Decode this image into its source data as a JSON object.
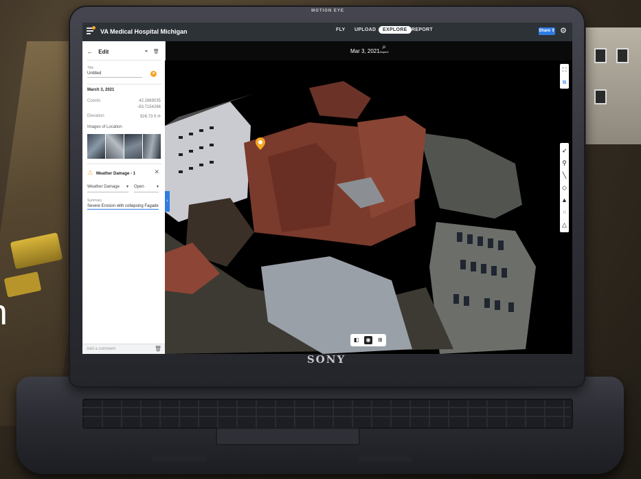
{
  "laptop": {
    "top_brand": "MOTION EYE",
    "bottom_brand": "SONY"
  },
  "app": {
    "title": "VA Medical Hospital Michigan",
    "nav": [
      "FLY",
      "UPLOAD",
      "EXPLORE",
      "REPORT"
    ],
    "active_nav": "EXPLORE",
    "share_label": "Share",
    "date": "Mar 3, 2021",
    "inspect_label": "Inspect"
  },
  "panel": {
    "back_label": "Edit",
    "title_label": "Title",
    "title_value": "Untitled",
    "date_heading": "March 3, 2021",
    "coords_label": "Coords",
    "coords_lat": "42.2869035",
    "coords_lng": "-83.7154266",
    "elevation_label": "Elevation",
    "elevation_value": "926.73 ft",
    "images_label": "Images of Location",
    "issue_title": "Weather Damage - 1",
    "issue_type": "Weather Damage",
    "issue_status": "Open",
    "summary_label": "Summary",
    "summary_value": "Severe Erosion with collapsing Fagade",
    "comment_placeholder": "Add a comment"
  },
  "icons": {
    "colors": {
      "accent": "#2f7de1",
      "warning": "#f5a623",
      "topbar": "#2d3237"
    }
  }
}
